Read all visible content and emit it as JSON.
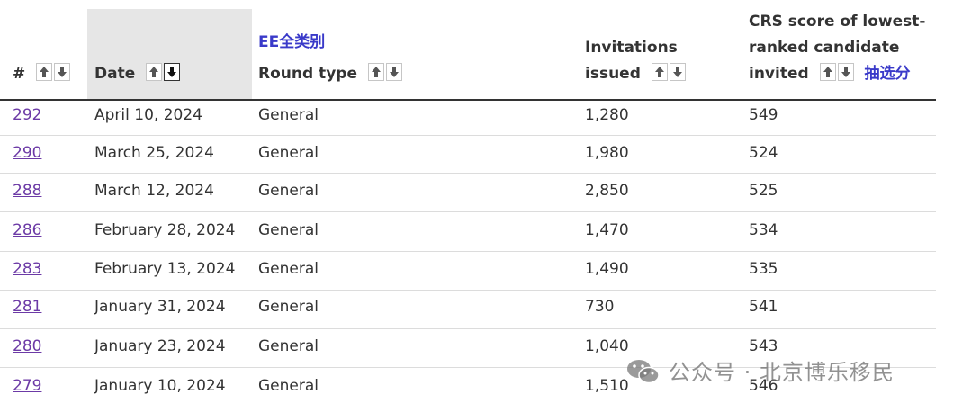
{
  "header": {
    "num_label": "#",
    "date_label": "Date",
    "tag_label": "EE全类别",
    "round_label": "Round type",
    "inv_label_1": "Invitations",
    "inv_label_2": "issued",
    "crs_label_1": "CRS score of lowest-",
    "crs_label_2": "ranked candidate",
    "crs_label_3": "invited",
    "crs_tag": "抽选分"
  },
  "rows": [
    {
      "num": "292",
      "date": "April 10, 2024",
      "type": "General",
      "invitations": "1,280",
      "crs": "549"
    },
    {
      "num": "290",
      "date": "March 25, 2024",
      "type": "General",
      "invitations": "1,980",
      "crs": "524"
    },
    {
      "num": "288",
      "date": "March 12, 2024",
      "type": "General",
      "invitations": "2,850",
      "crs": "525"
    },
    {
      "num": "286",
      "date": "February 28, 2024",
      "type": "General",
      "invitations": "1,470",
      "crs": "534"
    },
    {
      "num": "283",
      "date": "February 13, 2024",
      "type": "General",
      "invitations": "1,490",
      "crs": "535"
    },
    {
      "num": "281",
      "date": "January 31, 2024",
      "type": "General",
      "invitations": "730",
      "crs": "541"
    },
    {
      "num": "280",
      "date": "January 23, 2024",
      "type": "General",
      "invitations": "1,040",
      "crs": "543"
    },
    {
      "num": "279",
      "date": "January 10, 2024",
      "type": "General",
      "invitations": "1,510",
      "crs": "546"
    }
  ],
  "watermark": {
    "text": "公众号 · 北京博乐移民",
    "icon": "wechat-icon"
  },
  "colors": {
    "link": "#6c3aa6",
    "tag": "#3a3ac9",
    "text": "#333333",
    "sorted_bg": "#e6e6e6"
  }
}
